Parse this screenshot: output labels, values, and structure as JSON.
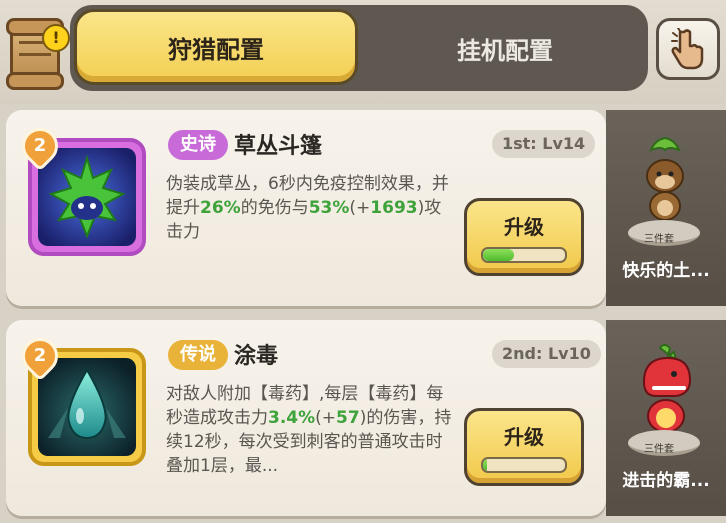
{
  "tabs": {
    "active": "狩猎配置",
    "inactive": "挂机配置"
  },
  "alert_badge": "!",
  "skills": [
    {
      "badge": "2",
      "rarity": "史诗",
      "name": "草丛斗篷",
      "rank": "1st: Lv14",
      "desc": [
        "伪装成草丛，6秒内免疫控制效果，并提升",
        "26%",
        "的免伤与",
        "53%",
        "(+",
        "1693",
        ")攻击力"
      ],
      "upgrade_label": "升级",
      "progress": 0.38,
      "set": {
        "tag": "三件套",
        "name": "快乐的土..."
      }
    },
    {
      "badge": "2",
      "rarity": "传说",
      "name": "涂毒",
      "rank": "2nd: Lv10",
      "desc": [
        "对敌人附加【毒药】,每层【毒药】每秒造成攻击力",
        "3.4%",
        "(+",
        "57",
        ")的伤害，持续12秒，每次受到刺客的普通攻击时叠加1层，最..."
      ],
      "upgrade_label": "升级",
      "progress": 0.05,
      "set": {
        "tag": "三件套",
        "name": "进击的霸..."
      }
    }
  ],
  "colors": {
    "highlight": "#3ea33a",
    "epic": "#c96ad9",
    "legend": "#e9b33a",
    "button": "#f3cf52"
  },
  "icons": [
    "scroll-icon",
    "hand-pointer-icon",
    "grass-cloak-icon",
    "poison-drop-icon",
    "monkey-figure-icon",
    "red-dino-figure-icon"
  ]
}
